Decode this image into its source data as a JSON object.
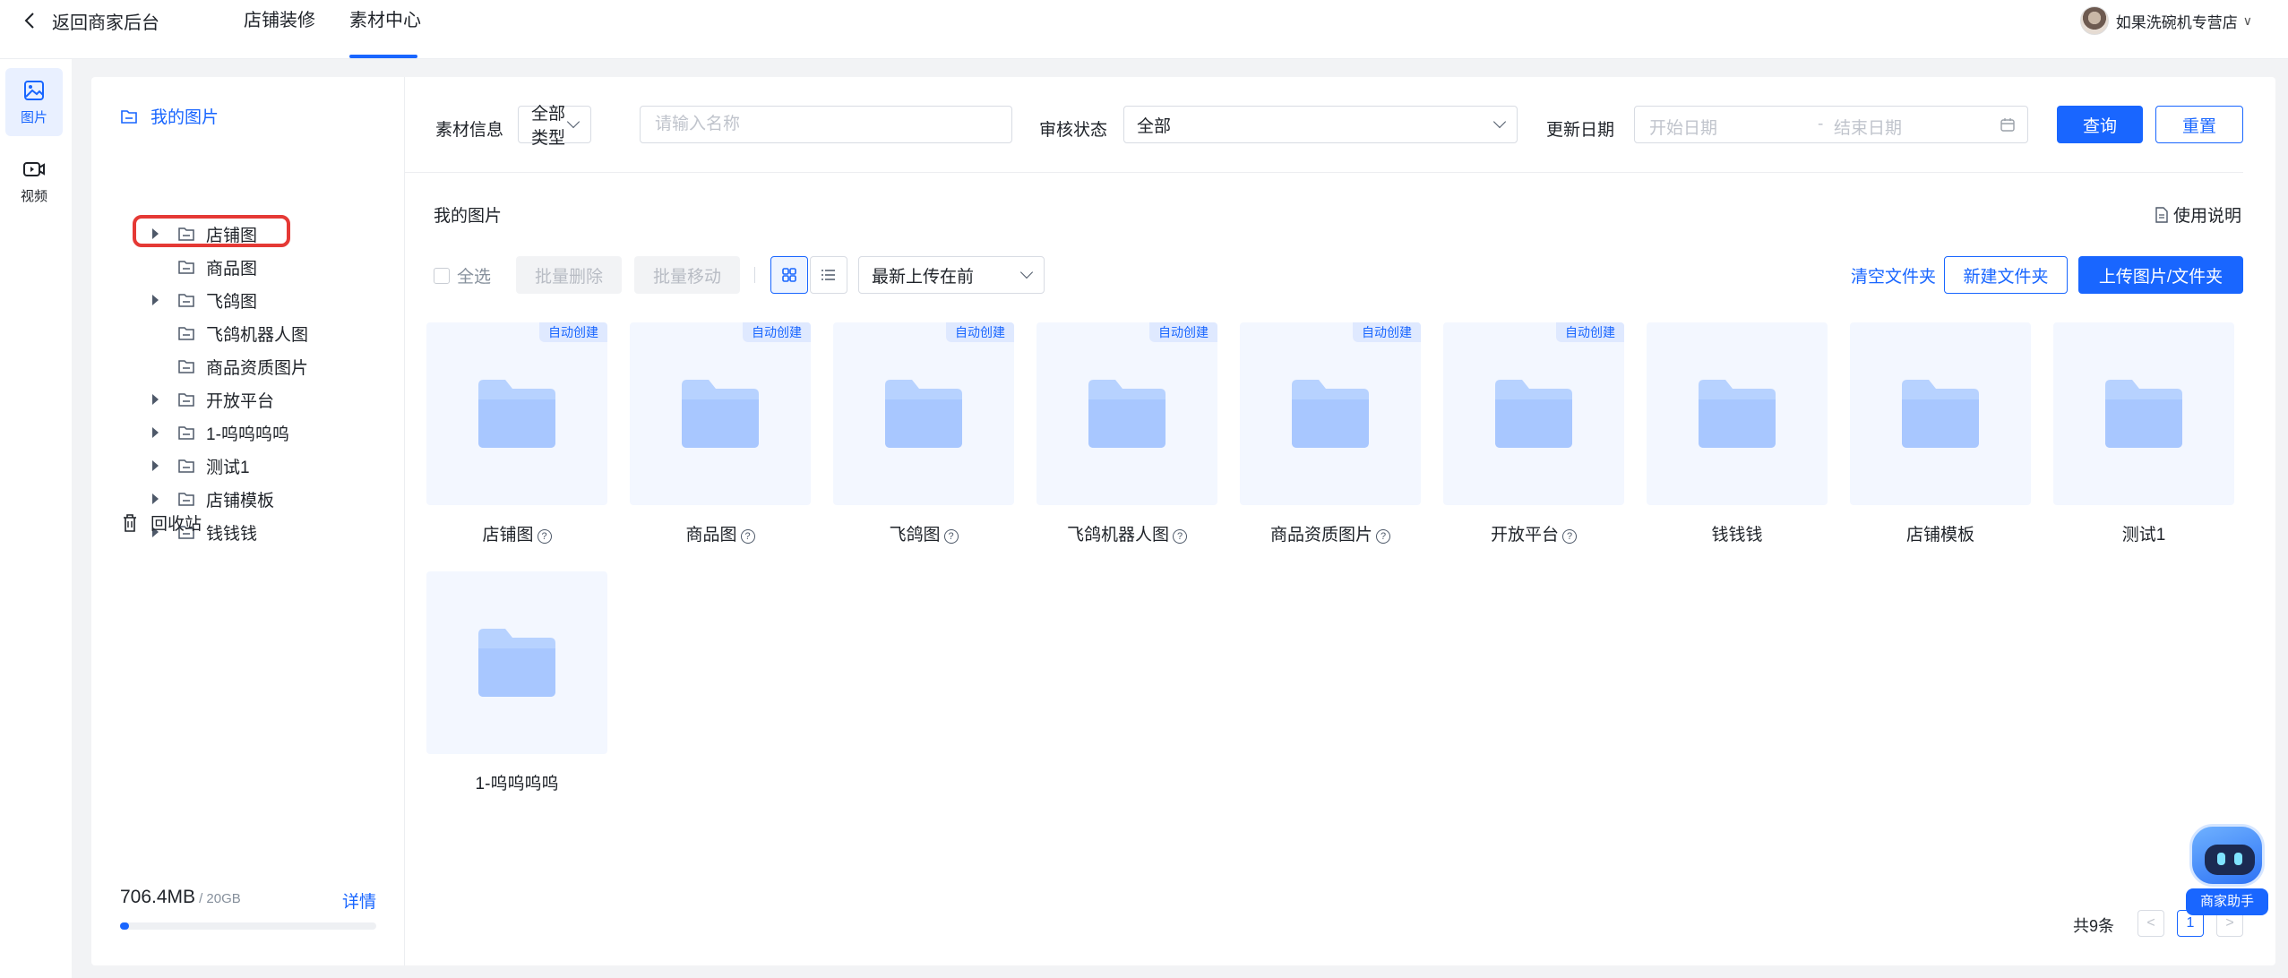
{
  "topbar": {
    "back_label": "返回商家后台",
    "tabs": [
      "店铺装修",
      "素材中心"
    ],
    "active_tab": "素材中心",
    "shop_name": "如果洗碗机专营店"
  },
  "rail": {
    "items": [
      {
        "label": "图片",
        "icon": "image-icon",
        "active": true
      },
      {
        "label": "视频",
        "icon": "video-icon",
        "active": false
      }
    ]
  },
  "tree": {
    "root": "我的图片",
    "folders": [
      {
        "label": "店铺图",
        "expandable": true
      },
      {
        "label": "商品图",
        "expandable": false
      },
      {
        "label": "飞鸽图",
        "expandable": true,
        "highlighted": true
      },
      {
        "label": "飞鸽机器人图",
        "expandable": false
      },
      {
        "label": "商品资质图片",
        "expandable": false
      },
      {
        "label": "开放平台",
        "expandable": true
      },
      {
        "label": "1-呜呜呜呜",
        "expandable": true
      },
      {
        "label": "测试1",
        "expandable": true
      },
      {
        "label": "店铺模板",
        "expandable": true
      },
      {
        "label": "钱钱钱",
        "expandable": true
      }
    ],
    "recycle": "回收站",
    "storage": {
      "used": "706.4MB",
      "total": "/ 20GB",
      "detail": "详情",
      "fraction": 0.034
    }
  },
  "filters": {
    "material_label": "素材信息",
    "type_value": "全部类型",
    "name_placeholder": "请输入名称",
    "review_label": "审核状态",
    "review_value": "全部",
    "date_label": "更新日期",
    "date_start_placeholder": "开始日期",
    "date_sep": "-",
    "date_end_placeholder": "结束日期",
    "query_btn": "查询",
    "reset_btn": "重置"
  },
  "content": {
    "title": "我的图片",
    "usage": "使用说明",
    "select_all": "全选",
    "batch_delete": "批量删除",
    "batch_move": "批量移动",
    "sort_value": "最新上传在前",
    "clear_folder": "清空文件夹",
    "new_folder": "新建文件夹",
    "upload": "上传图片/文件夹",
    "auto_tag": "自动创建",
    "items": [
      {
        "name": "店铺图",
        "auto": true,
        "help": true
      },
      {
        "name": "商品图",
        "auto": true,
        "help": true
      },
      {
        "name": "飞鸽图",
        "auto": true,
        "help": true
      },
      {
        "name": "飞鸽机器人图",
        "auto": true,
        "help": true
      },
      {
        "name": "商品资质图片",
        "auto": true,
        "help": true
      },
      {
        "name": "开放平台",
        "auto": true,
        "help": true
      },
      {
        "name": "钱钱钱",
        "auto": false,
        "help": false
      },
      {
        "name": "店铺模板",
        "auto": false,
        "help": false
      },
      {
        "name": "测试1",
        "auto": false,
        "help": false
      },
      {
        "name": "1-呜呜呜呜",
        "auto": false,
        "help": false
      }
    ]
  },
  "pagination": {
    "total": "共9条",
    "current": "1",
    "prev": "<",
    "next": ">"
  },
  "assistant": {
    "label": "商家助手"
  },
  "colors": {
    "accent": "#1966ff",
    "highlight": "#e53935",
    "tile_bg": "#f3f7ff",
    "folder": "#b7d2ff"
  }
}
